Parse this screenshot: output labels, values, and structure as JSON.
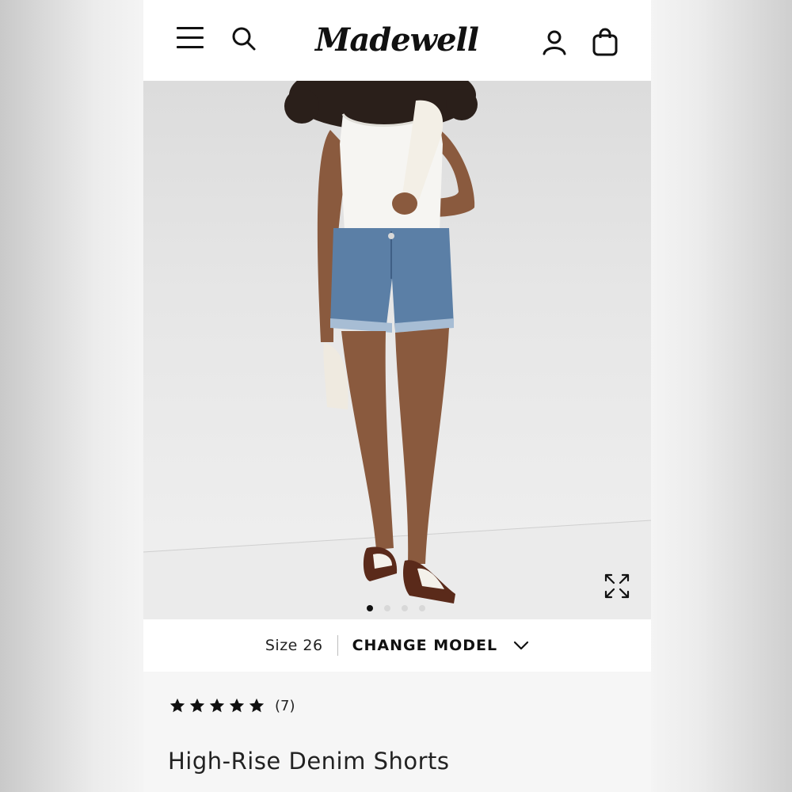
{
  "header": {
    "brand": "Madewell",
    "icons": [
      "menu-icon",
      "search-icon",
      "account-icon",
      "bag-icon"
    ]
  },
  "gallery": {
    "image_description_icons": [
      "expand-icon"
    ],
    "slides_count": 4,
    "active_slide": 1
  },
  "size_row": {
    "size_label": "Size 26",
    "change_model_label": "CHANGE MODEL"
  },
  "product": {
    "rating": 5,
    "review_count": "(7)",
    "title": "High-Rise Denim Shorts"
  },
  "colors": {
    "text": "#111111",
    "denim": "#5b7fa6",
    "background": "#f6f6f6"
  }
}
